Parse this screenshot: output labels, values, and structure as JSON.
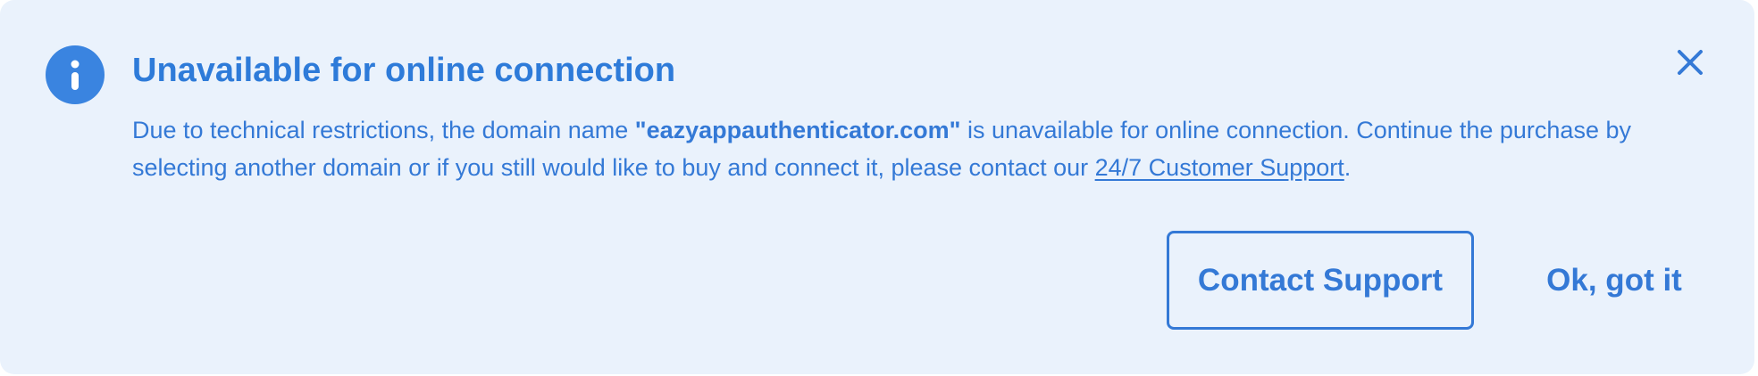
{
  "alert": {
    "title": "Unavailable for online connection",
    "message_part1": "Due to technical restrictions, the domain name ",
    "domain_name": "\"eazyappauthenticator.com\"",
    "message_part2": " is unavailable for online connection. Continue the purchase by selecting another domain or if you still would like to buy and connect it, please contact our ",
    "support_link_label": "24/7 Customer Support",
    "message_end": ".",
    "icon": "info-icon",
    "close_icon": "close-icon",
    "accent_color": "#3479d6",
    "background_color": "#eaf2fc"
  },
  "actions": {
    "contact_label": "Contact Support",
    "ok_label": "Ok, got it"
  }
}
